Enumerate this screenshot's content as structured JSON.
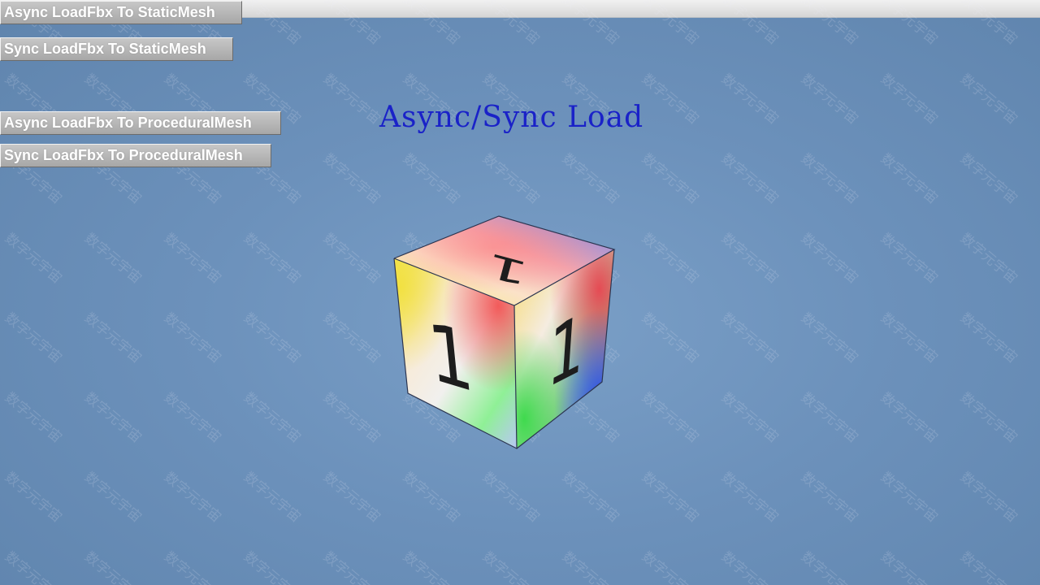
{
  "buttons": {
    "async_static": "Async LoadFbx To StaticMesh",
    "sync_static": "Sync LoadFbx To StaticMesh",
    "async_procedural": "Async LoadFbx To ProceduralMesh",
    "sync_procedural": "Sync LoadFbx To ProceduralMesh"
  },
  "title": "Async/Sync Load",
  "cube": {
    "face_label": "1"
  },
  "watermark": {
    "text": "数字元宇宙"
  },
  "colors": {
    "title": "#1a22c8",
    "background": "#6c91bb",
    "button": "#b5b5b5"
  }
}
